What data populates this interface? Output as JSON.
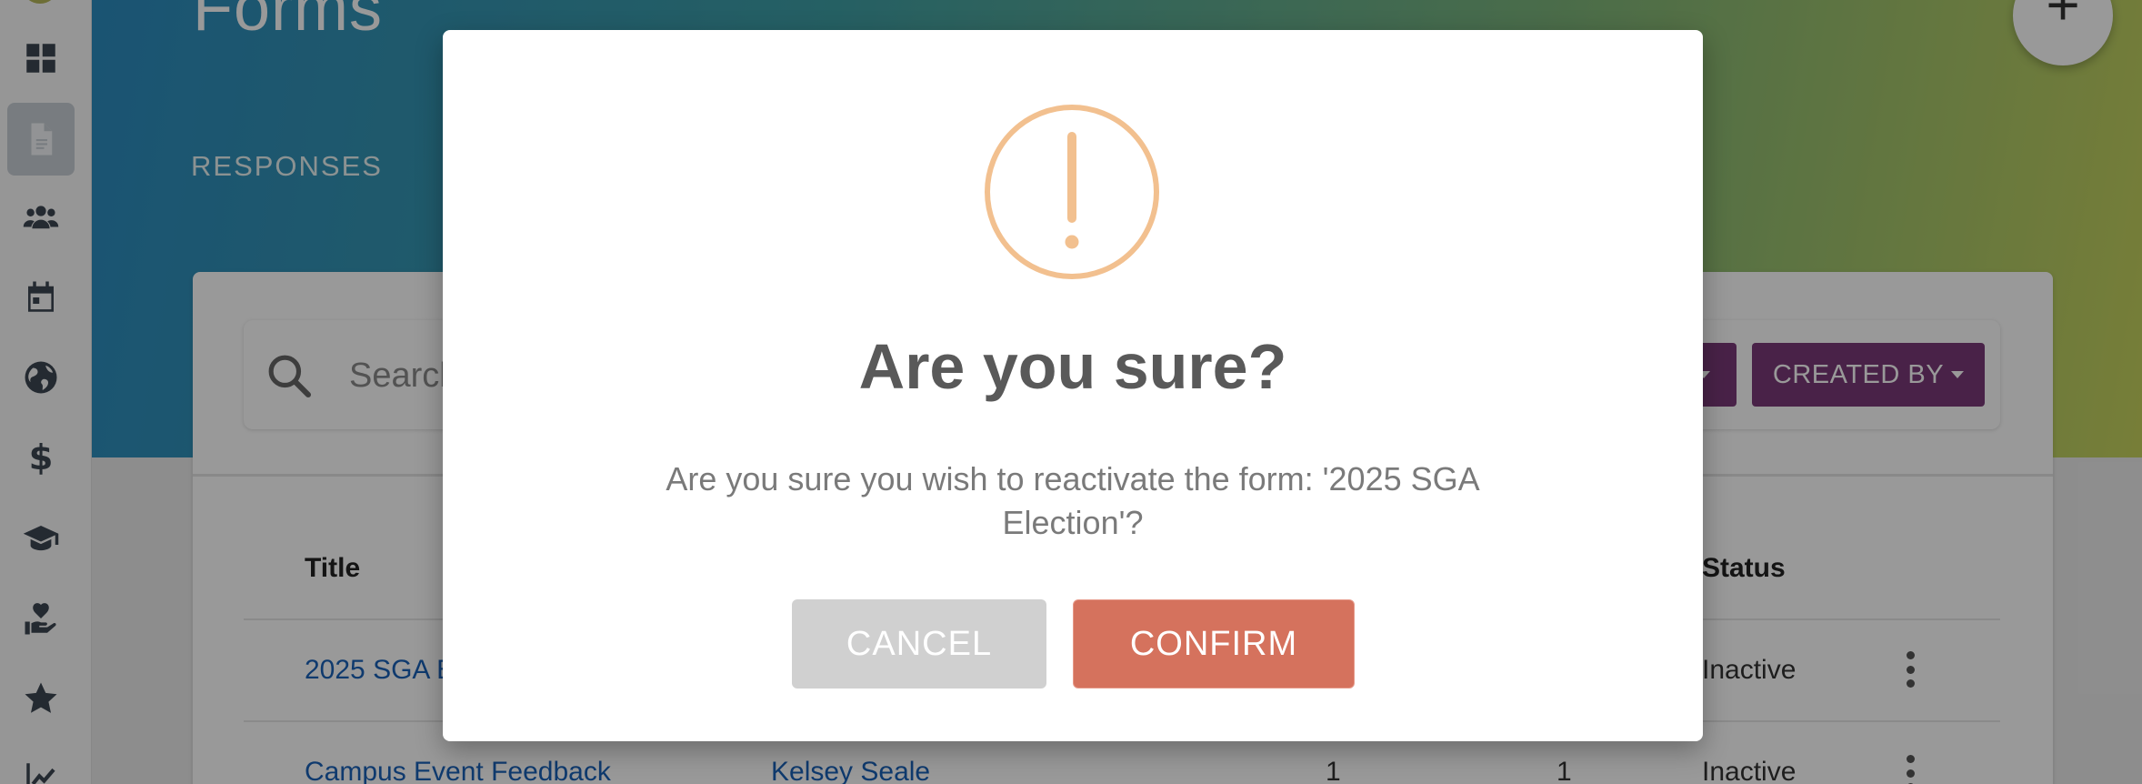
{
  "app": {
    "page_title": "Forms",
    "tab_label": "RESPONSES",
    "fab_label": "+"
  },
  "sidebar": {
    "items": [
      {
        "icon": "dashboard-icon",
        "active": false
      },
      {
        "icon": "form-document-icon",
        "active": true
      },
      {
        "icon": "users-icon",
        "active": false
      },
      {
        "icon": "calendar-icon",
        "active": false
      },
      {
        "icon": "globe-icon",
        "active": false
      },
      {
        "icon": "dollar-icon",
        "active": false
      },
      {
        "icon": "graduation-cap-icon",
        "active": false
      },
      {
        "icon": "hand-heart-icon",
        "active": false
      },
      {
        "icon": "star-icon",
        "active": false
      },
      {
        "icon": "chart-line-icon",
        "active": false
      }
    ]
  },
  "filters": {
    "search_placeholder": "Search",
    "created_by_label": "CREATED BY"
  },
  "table": {
    "headers": {
      "title": "Title",
      "status": "Status"
    },
    "rows": [
      {
        "title": "2025 SGA E",
        "creator": "",
        "col3": "",
        "col4": "",
        "status": "Inactive"
      },
      {
        "title": "Campus Event Feedback",
        "creator": "Kelsey Seale",
        "col3": "1",
        "col4": "1",
        "status": "Inactive"
      }
    ]
  },
  "modal": {
    "title": "Are you sure?",
    "message": "Are you sure you wish to reactivate the form: '2025 SGA Election'?",
    "cancel_label": "CANCEL",
    "confirm_label": "CONFIRM",
    "icon": "warning-exclamation-icon"
  },
  "colors": {
    "brand_purple": "#7b3a78",
    "confirm": "#d5725d",
    "cancel": "#d0d0d0",
    "warning": "#f2c08f",
    "link": "#1a62b8"
  }
}
